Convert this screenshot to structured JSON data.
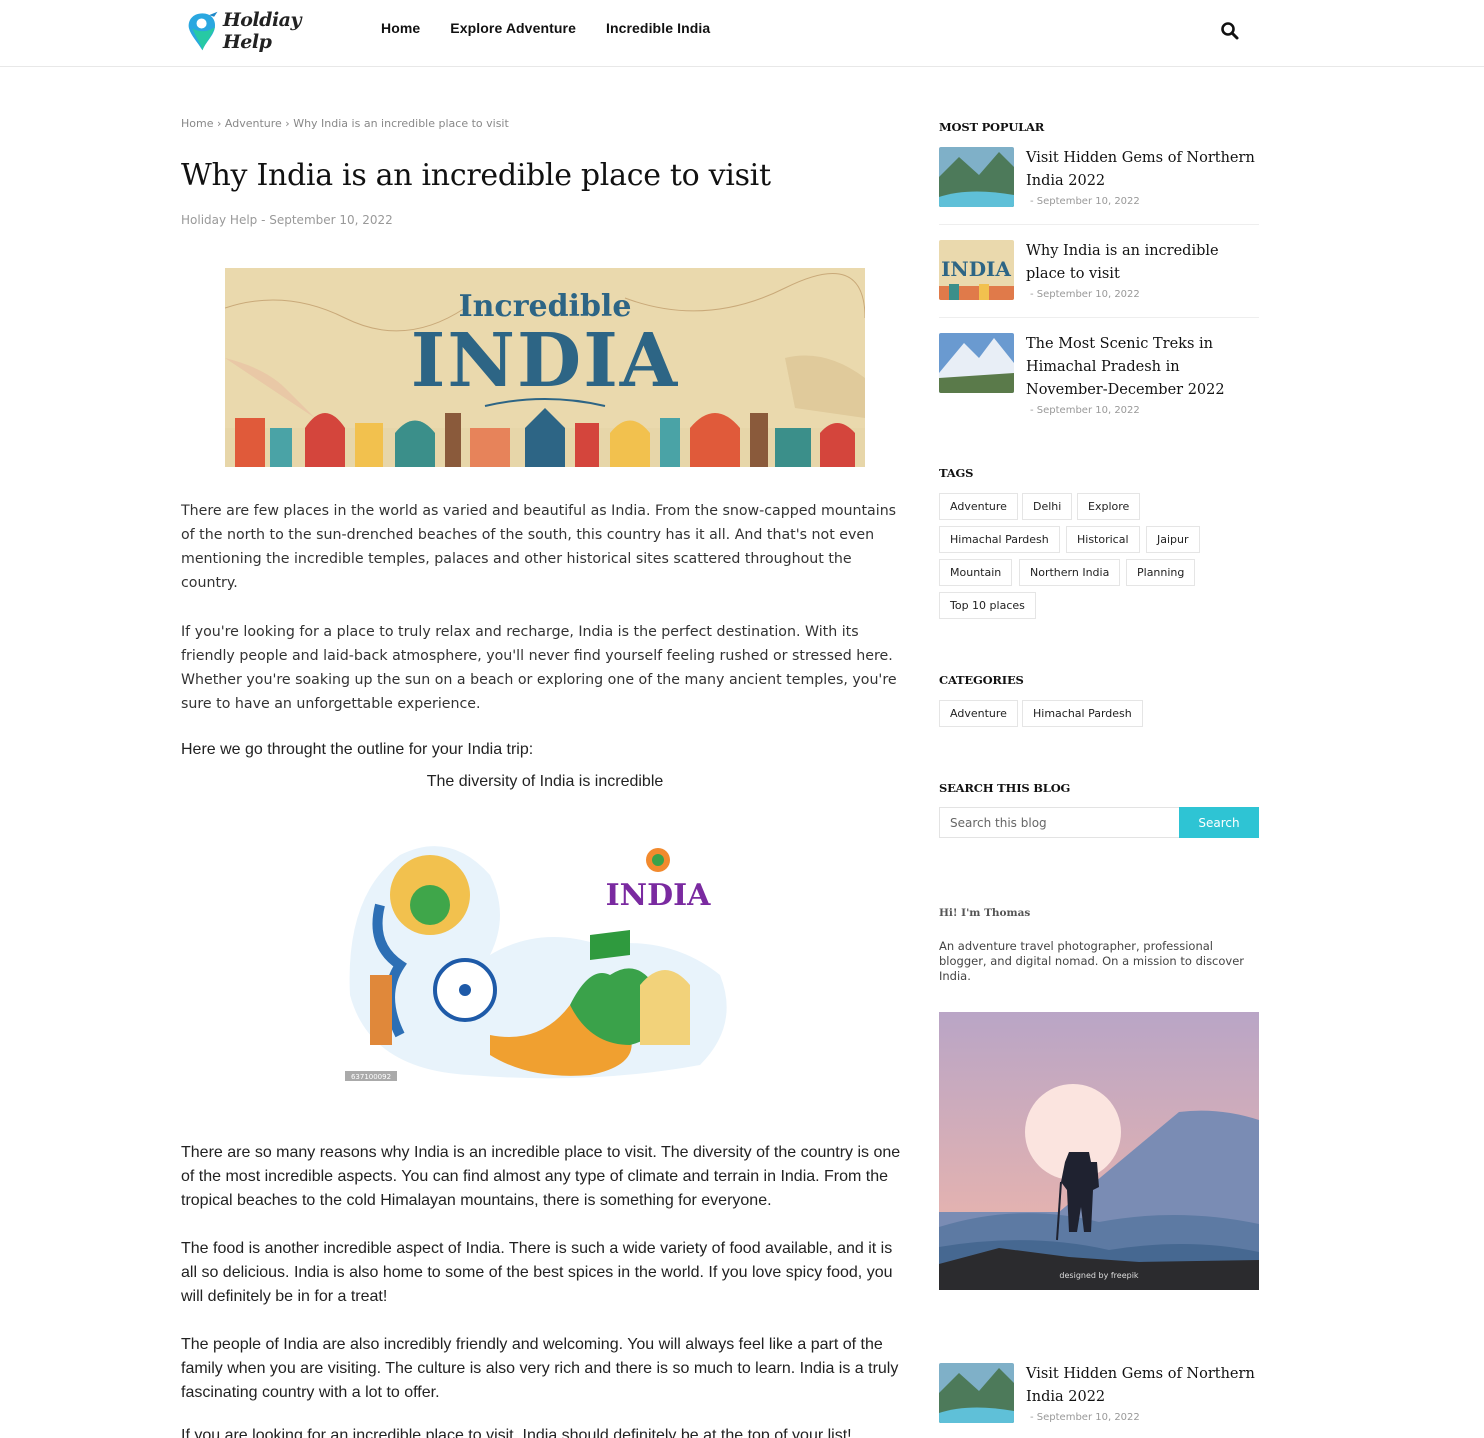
{
  "header": {
    "logo_text": "Holdiay Help",
    "nav": [
      "Home",
      "Explore Adventure",
      "Incredible India"
    ]
  },
  "breadcrumb": {
    "home": "Home",
    "sep1": "›",
    "category": "Adventure",
    "sep2": "›",
    "current": "Why India is an incredible place to visit"
  },
  "post": {
    "title": "Why India is an incredible place to visit",
    "meta": "Holiday Help - September 10, 2022",
    "hero_text_top": "Incredible",
    "hero_text_main": "INDIA",
    "paragraphs": [
      "There are few places in the world as varied and beautiful as India. From the snow-capped mountains of the north to the sun-drenched beaches of the south, this country has it all. And that's not even mentioning the incredible temples, palaces and other historical sites scattered throughout the country.",
      "If you're looking for a place to truly relax and recharge, India is the perfect destination. With its friendly people and laid-back atmosphere, you'll never find yourself feeling rushed or stressed here. Whether you're soaking up the sun on a beach or exploring one of the many ancient temples, you're sure to have an unforgettable experience."
    ],
    "outline": "Here we go throught the outline for your India trip:",
    "caption": "The diversity of India is incredible",
    "art_label": "INDIA",
    "art_id": "637100092",
    "body": [
      "There are so many reasons why India is an incredible place to visit. The diversity of the country is one of the most incredible aspects. You can find almost any type of climate and terrain in India. From the tropical beaches to the cold Himalayan mountains, there is something for everyone.",
      "The food is another incredible aspect of India. There is such a wide variety of food available, and it is all so delicious. India is also home to some of the best spices in the world. If you love spicy food, you will definitely be in for a treat!",
      "The people of India are also incredibly friendly and welcoming. You will always feel like a part of the family when you are visiting. The culture is also very rich and there is so much to learn. India is a truly fascinating country with a lot to offer.",
      "If you are looking for an incredible place to visit, India should definitely be at the top of your list!"
    ]
  },
  "sidebar": {
    "popular_heading": "MOST POPULAR",
    "popular": [
      {
        "title": "Visit Hidden Gems of Northern India 2022",
        "date": "- September 10, 2022"
      },
      {
        "title": "Why India is an incredible place to visit",
        "date": "- September 10, 2022"
      },
      {
        "title": "The Most Scenic Treks in Himachal Pradesh in November-December 2022",
        "date": "- September 10, 2022"
      }
    ],
    "tags_heading": "TAGS",
    "tags": [
      "Adventure",
      "Delhi",
      "Explore",
      "Himachal Pardesh",
      "Historical",
      "Jaipur",
      "Mountain",
      "Northern India",
      "Planning",
      "Top 10 places"
    ],
    "categories_heading": "CATEGORIES",
    "categories": [
      "Adventure",
      "Himachal Pardesh"
    ],
    "search_heading": "SEARCH THIS BLOG",
    "search_placeholder": "Search this blog",
    "search_button": "Search",
    "about_name": "Hi! I'm Thomas",
    "about_text": "An adventure travel photographer, professional blogger, and digital nomad. On a mission to discover India.",
    "about_credit": "designed by  freepik",
    "bottom_popular": {
      "title": "Visit Hidden Gems of Northern India 2022",
      "date": "- September 10, 2022"
    }
  }
}
